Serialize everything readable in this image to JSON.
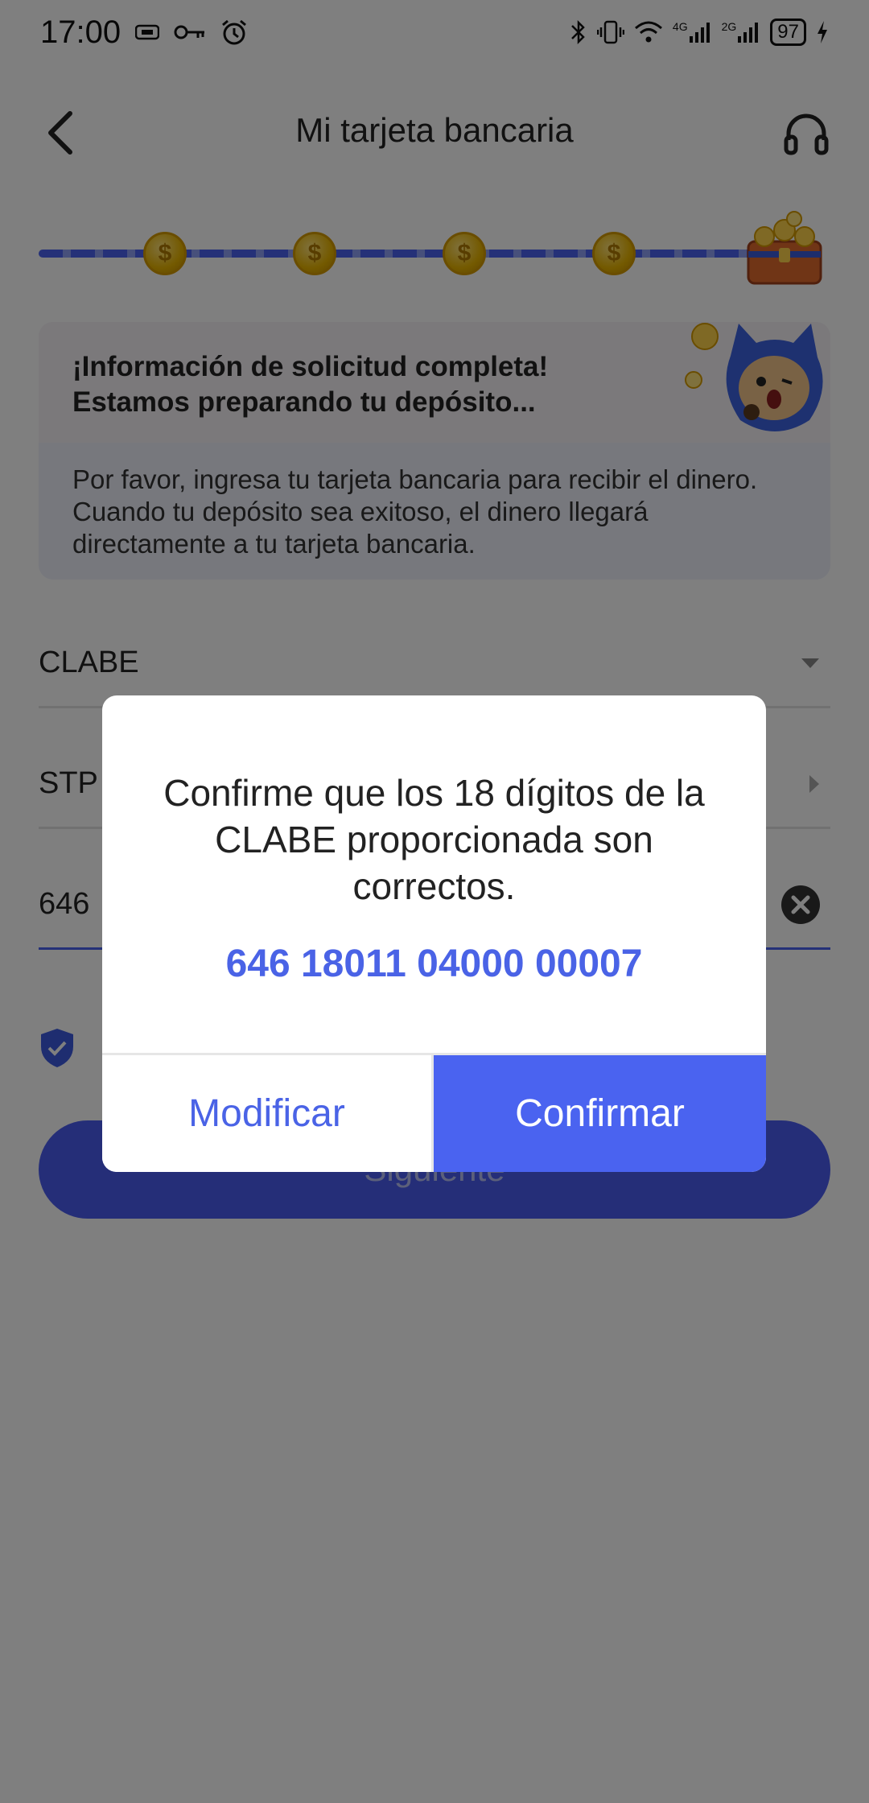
{
  "status_bar": {
    "time": "17:00",
    "battery": "97",
    "network_4g": "4G",
    "network_2g": "2G"
  },
  "header": {
    "title": "Mi tarjeta bancaria"
  },
  "info_card": {
    "title_line1": "¡Información de solicitud completa!",
    "title_line2": "Estamos preparando tu depósito...",
    "body": "Por favor, ingresa tu tarjeta bancaria para recibir el dinero. Cuando tu depósito sea exitoso, el dinero llegará directamente a tu tarjeta bancaria."
  },
  "form": {
    "account_type": "CLABE",
    "bank": "STP",
    "account_number": "646"
  },
  "next_button": "Siguiente",
  "dialog": {
    "message": "Confirme que los 18 dígitos de la CLABE proporcionada son correctos.",
    "number": "646 18011 04000 00007",
    "modify_label": "Modificar",
    "confirm_label": "Confirmar"
  },
  "colors": {
    "accent": "#4a63f0",
    "overlay": "rgba(0,0,0,0.5)"
  }
}
